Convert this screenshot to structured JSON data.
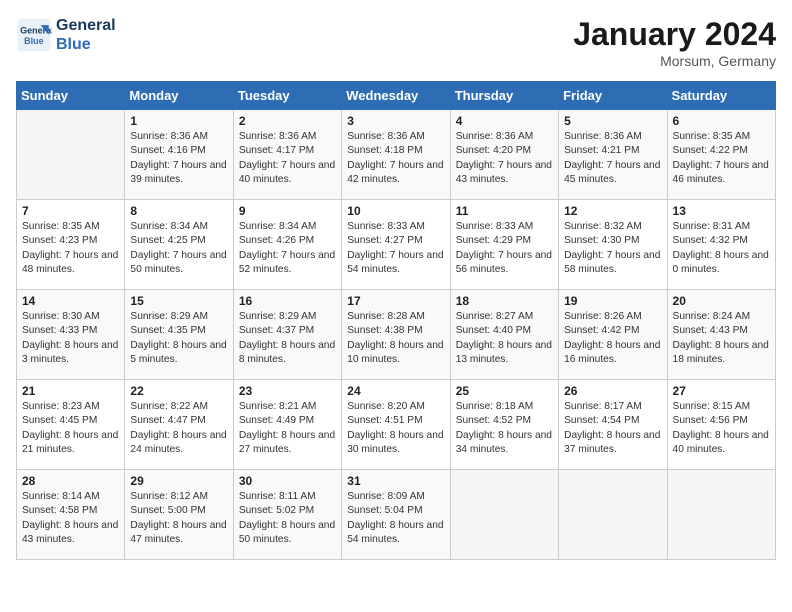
{
  "header": {
    "logo_line1": "General",
    "logo_line2": "Blue",
    "month_title": "January 2024",
    "location": "Morsum, Germany"
  },
  "weekdays": [
    "Sunday",
    "Monday",
    "Tuesday",
    "Wednesday",
    "Thursday",
    "Friday",
    "Saturday"
  ],
  "weeks": [
    [
      {
        "day": "",
        "sunrise": "",
        "sunset": "",
        "daylight": ""
      },
      {
        "day": "1",
        "sunrise": "Sunrise: 8:36 AM",
        "sunset": "Sunset: 4:16 PM",
        "daylight": "Daylight: 7 hours and 39 minutes."
      },
      {
        "day": "2",
        "sunrise": "Sunrise: 8:36 AM",
        "sunset": "Sunset: 4:17 PM",
        "daylight": "Daylight: 7 hours and 40 minutes."
      },
      {
        "day": "3",
        "sunrise": "Sunrise: 8:36 AM",
        "sunset": "Sunset: 4:18 PM",
        "daylight": "Daylight: 7 hours and 42 minutes."
      },
      {
        "day": "4",
        "sunrise": "Sunrise: 8:36 AM",
        "sunset": "Sunset: 4:20 PM",
        "daylight": "Daylight: 7 hours and 43 minutes."
      },
      {
        "day": "5",
        "sunrise": "Sunrise: 8:36 AM",
        "sunset": "Sunset: 4:21 PM",
        "daylight": "Daylight: 7 hours and 45 minutes."
      },
      {
        "day": "6",
        "sunrise": "Sunrise: 8:35 AM",
        "sunset": "Sunset: 4:22 PM",
        "daylight": "Daylight: 7 hours and 46 minutes."
      }
    ],
    [
      {
        "day": "7",
        "sunrise": "Sunrise: 8:35 AM",
        "sunset": "Sunset: 4:23 PM",
        "daylight": "Daylight: 7 hours and 48 minutes."
      },
      {
        "day": "8",
        "sunrise": "Sunrise: 8:34 AM",
        "sunset": "Sunset: 4:25 PM",
        "daylight": "Daylight: 7 hours and 50 minutes."
      },
      {
        "day": "9",
        "sunrise": "Sunrise: 8:34 AM",
        "sunset": "Sunset: 4:26 PM",
        "daylight": "Daylight: 7 hours and 52 minutes."
      },
      {
        "day": "10",
        "sunrise": "Sunrise: 8:33 AM",
        "sunset": "Sunset: 4:27 PM",
        "daylight": "Daylight: 7 hours and 54 minutes."
      },
      {
        "day": "11",
        "sunrise": "Sunrise: 8:33 AM",
        "sunset": "Sunset: 4:29 PM",
        "daylight": "Daylight: 7 hours and 56 minutes."
      },
      {
        "day": "12",
        "sunrise": "Sunrise: 8:32 AM",
        "sunset": "Sunset: 4:30 PM",
        "daylight": "Daylight: 7 hours and 58 minutes."
      },
      {
        "day": "13",
        "sunrise": "Sunrise: 8:31 AM",
        "sunset": "Sunset: 4:32 PM",
        "daylight": "Daylight: 8 hours and 0 minutes."
      }
    ],
    [
      {
        "day": "14",
        "sunrise": "Sunrise: 8:30 AM",
        "sunset": "Sunset: 4:33 PM",
        "daylight": "Daylight: 8 hours and 3 minutes."
      },
      {
        "day": "15",
        "sunrise": "Sunrise: 8:29 AM",
        "sunset": "Sunset: 4:35 PM",
        "daylight": "Daylight: 8 hours and 5 minutes."
      },
      {
        "day": "16",
        "sunrise": "Sunrise: 8:29 AM",
        "sunset": "Sunset: 4:37 PM",
        "daylight": "Daylight: 8 hours and 8 minutes."
      },
      {
        "day": "17",
        "sunrise": "Sunrise: 8:28 AM",
        "sunset": "Sunset: 4:38 PM",
        "daylight": "Daylight: 8 hours and 10 minutes."
      },
      {
        "day": "18",
        "sunrise": "Sunrise: 8:27 AM",
        "sunset": "Sunset: 4:40 PM",
        "daylight": "Daylight: 8 hours and 13 minutes."
      },
      {
        "day": "19",
        "sunrise": "Sunrise: 8:26 AM",
        "sunset": "Sunset: 4:42 PM",
        "daylight": "Daylight: 8 hours and 16 minutes."
      },
      {
        "day": "20",
        "sunrise": "Sunrise: 8:24 AM",
        "sunset": "Sunset: 4:43 PM",
        "daylight": "Daylight: 8 hours and 18 minutes."
      }
    ],
    [
      {
        "day": "21",
        "sunrise": "Sunrise: 8:23 AM",
        "sunset": "Sunset: 4:45 PM",
        "daylight": "Daylight: 8 hours and 21 minutes."
      },
      {
        "day": "22",
        "sunrise": "Sunrise: 8:22 AM",
        "sunset": "Sunset: 4:47 PM",
        "daylight": "Daylight: 8 hours and 24 minutes."
      },
      {
        "day": "23",
        "sunrise": "Sunrise: 8:21 AM",
        "sunset": "Sunset: 4:49 PM",
        "daylight": "Daylight: 8 hours and 27 minutes."
      },
      {
        "day": "24",
        "sunrise": "Sunrise: 8:20 AM",
        "sunset": "Sunset: 4:51 PM",
        "daylight": "Daylight: 8 hours and 30 minutes."
      },
      {
        "day": "25",
        "sunrise": "Sunrise: 8:18 AM",
        "sunset": "Sunset: 4:52 PM",
        "daylight": "Daylight: 8 hours and 34 minutes."
      },
      {
        "day": "26",
        "sunrise": "Sunrise: 8:17 AM",
        "sunset": "Sunset: 4:54 PM",
        "daylight": "Daylight: 8 hours and 37 minutes."
      },
      {
        "day": "27",
        "sunrise": "Sunrise: 8:15 AM",
        "sunset": "Sunset: 4:56 PM",
        "daylight": "Daylight: 8 hours and 40 minutes."
      }
    ],
    [
      {
        "day": "28",
        "sunrise": "Sunrise: 8:14 AM",
        "sunset": "Sunset: 4:58 PM",
        "daylight": "Daylight: 8 hours and 43 minutes."
      },
      {
        "day": "29",
        "sunrise": "Sunrise: 8:12 AM",
        "sunset": "Sunset: 5:00 PM",
        "daylight": "Daylight: 8 hours and 47 minutes."
      },
      {
        "day": "30",
        "sunrise": "Sunrise: 8:11 AM",
        "sunset": "Sunset: 5:02 PM",
        "daylight": "Daylight: 8 hours and 50 minutes."
      },
      {
        "day": "31",
        "sunrise": "Sunrise: 8:09 AM",
        "sunset": "Sunset: 5:04 PM",
        "daylight": "Daylight: 8 hours and 54 minutes."
      },
      {
        "day": "",
        "sunrise": "",
        "sunset": "",
        "daylight": ""
      },
      {
        "day": "",
        "sunrise": "",
        "sunset": "",
        "daylight": ""
      },
      {
        "day": "",
        "sunrise": "",
        "sunset": "",
        "daylight": ""
      }
    ]
  ]
}
